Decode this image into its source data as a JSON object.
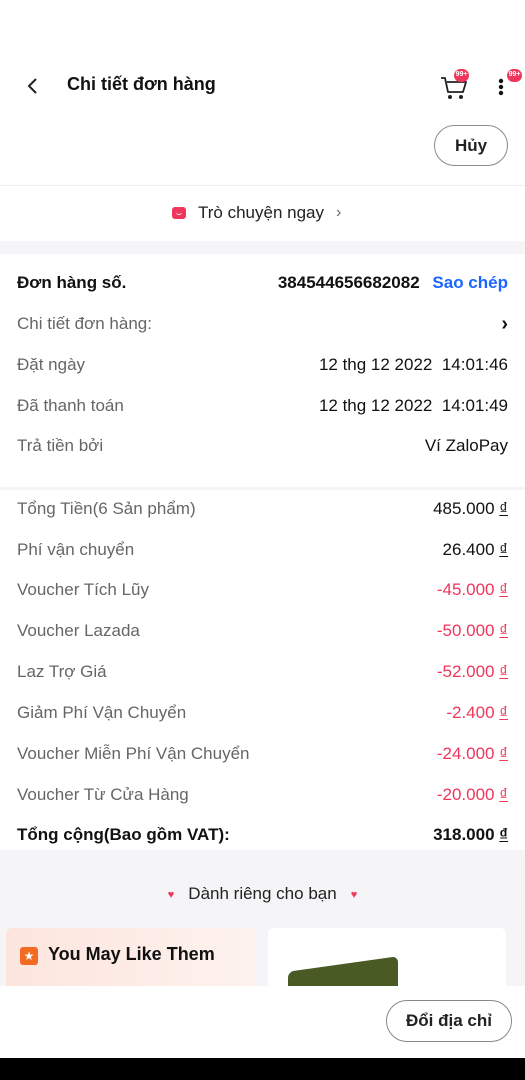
{
  "header": {
    "back_icon": "chevron-left-icon",
    "title": "Chi tiết đơn hàng",
    "cart_badge": "99+",
    "more_badge": "99+",
    "cancel_label": "Hủy"
  },
  "chat": {
    "label": "Trò chuyện ngay",
    "chevron": "›"
  },
  "order_info": {
    "order_no_label": "Đơn hàng số.",
    "order_no_value": "384544656682082",
    "copy_label": "Sao chép",
    "detail_label": "Chi tiết đơn hàng:",
    "detail_chevron": "›",
    "placed_label": "Đặt ngày",
    "placed_value": "12 thg 12 2022  14:01:46",
    "paid_label": "Đã thanh toán",
    "paid_value": "12 thg 12 2022  14:01:49",
    "paid_by_label": "Trả tiền bởi",
    "paid_by_value": "Ví ZaloPay"
  },
  "price_summary": {
    "currency_symbol": "₫",
    "rows": [
      {
        "label": "Tổng Tiền(6 Sản phẩm)",
        "amount": "485.000"
      },
      {
        "label": "Phí vận chuyển",
        "amount": "26.400"
      },
      {
        "label": "Voucher Tích Lũy",
        "amount": "-45.000"
      },
      {
        "label": "Voucher Lazada",
        "amount": "-50.000"
      },
      {
        "label": "Laz Trợ Giá",
        "amount": "-52.000"
      },
      {
        "label": "Giảm Phí Vận Chuyển",
        "amount": "-2.400"
      },
      {
        "label": "Voucher Miễn Phí Vận Chuyển",
        "amount": "-24.000"
      },
      {
        "label": "Voucher Từ Cửa Hàng",
        "amount": "-20.000"
      }
    ],
    "total_label": "Tổng cộng(Bao gồm VAT):",
    "total_amount": "318.000"
  },
  "recommend": {
    "title": "Dành riêng cho bạn",
    "card_title": "You May Like Them"
  },
  "footer": {
    "change_address_label": "Đổi địa chỉ"
  },
  "colors": {
    "accent_red": "#f0365a",
    "link_blue": "#1a66ff"
  }
}
